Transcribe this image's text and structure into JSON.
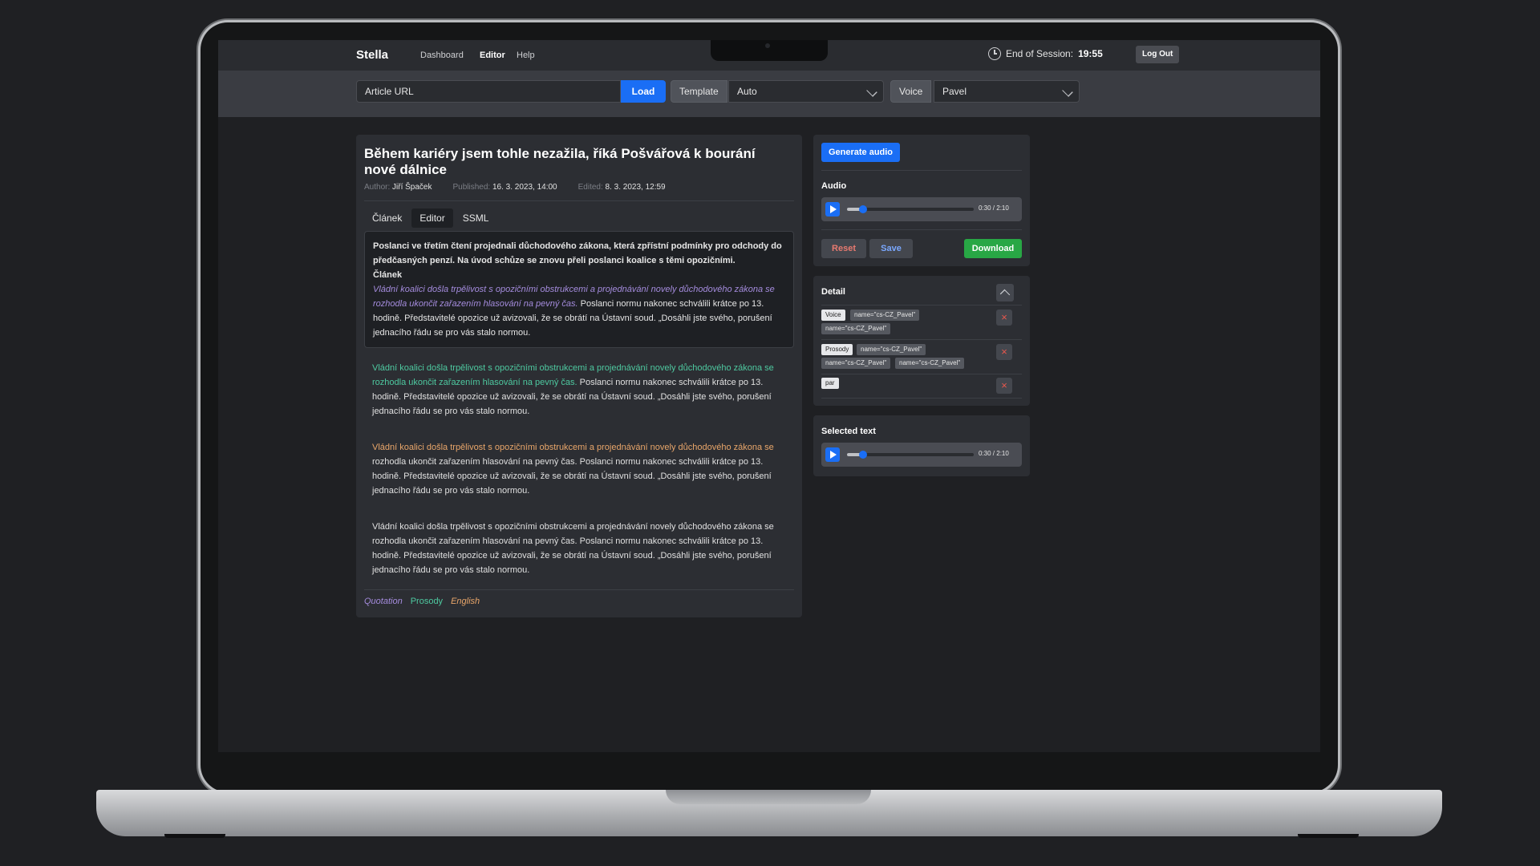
{
  "nav": {
    "brand": "Stella",
    "links": [
      "Dashboard",
      "Editor",
      "Help"
    ],
    "session_label": "End of Session:",
    "session_time": "19:55",
    "logout": "Log Out"
  },
  "toolbar": {
    "url_placeholder": "Article URL",
    "load": "Load",
    "template_label": "Template",
    "template_value": "Auto",
    "voice_label": "Voice",
    "voice_value": "Pavel"
  },
  "article": {
    "title": "Během kariéry jsem tohle nezažila, říká Pošvářová k bourání nové dálnice",
    "author_label": "Author:",
    "author": "Jiří Špaček",
    "published_label": "Published:",
    "published": "16. 3. 2023, 14:00",
    "edited_label": "Edited:",
    "edited": "8. 3. 2023, 12:59",
    "tabs": [
      "Článek",
      "Editor",
      "SSML"
    ],
    "active_tab": "Editor",
    "lead": "Poslanci ve třetím čtení projednali důchodového zákona, která zpřístní podmínky pro odchody do předčasných penzí. Na úvod schůze se znovu přeli poslanci koalice s těmi opozičními.",
    "section_heading": "Článek",
    "quote_text": "Vládní koalici došla trpělivost s opozičními obstrukcemi a projednávání novely důchodového zákona se rozhodla ukončit zařazením hlasování na pevný čas.",
    "rest_text": " Poslanci normu nakonec schválili krátce po 13. hodině. Představitelé opozice už avizovali, že se obrátí na Ústavní soud. „Dosáhli jste svého, porušení jednacího řádu se pro vás stalo normou.",
    "para_orange_highlight": "Vládní koalici došla trpělivost s opozičními obstrukcemi a projednávání novely důchodového zákona se",
    "para_orange_rest": " rozhodla ukončit zařazením hlasování na pevný čas. Poslanci normu nakonec schválili krátce po 13. hodině. Představitelé opozice už avizovali, že se obrátí na Ústavní soud. „Dosáhli jste svého, porušení jednacího řádu se pro vás stalo normou.",
    "para_plain": "Vládní koalici došla trpělivost s opozičními obstrukcemi a projednávání novely důchodového zákona se rozhodla ukončit zařazením hlasování na pevný čas. Poslanci normu nakonec schválili krátce po 13. hodině. Představitelé opozice už avizovali, že se obrátí na Ústavní soud. „Dosáhli jste svého, porušení jednacího řádu se pro vás stalo normou.",
    "legend": [
      "Quotation",
      "Prosody",
      "English"
    ]
  },
  "audio_panel": {
    "generate": "Generate audio",
    "audio_label": "Audio",
    "time": "0:30 / 2:10",
    "progress": 0.125,
    "reset": "Reset",
    "save": "Save",
    "download": "Download"
  },
  "detail": {
    "title": "Detail",
    "rows": [
      {
        "tag": "Voice",
        "attrs": [
          "name=\"cs-CZ_Pavel\"",
          "name=\"cs-CZ_Pavel\""
        ]
      },
      {
        "tag": "Prosody",
        "attrs": [
          "name=\"cs-CZ_Pavel\"",
          "name=\"cs-CZ_Pavel\"",
          "name=\"cs-CZ_Pavel\""
        ]
      },
      {
        "tag": "par",
        "attrs": []
      }
    ],
    "remove_symbol": "×"
  },
  "selected": {
    "title": "Selected text",
    "time": "0:30 / 2:10",
    "progress": 0.125
  },
  "colors": {
    "accent": "#1a6ef5",
    "quotation": "#a58cde",
    "prosody": "#4ec9a0",
    "english": "#e9a66a",
    "download": "#28a745"
  }
}
